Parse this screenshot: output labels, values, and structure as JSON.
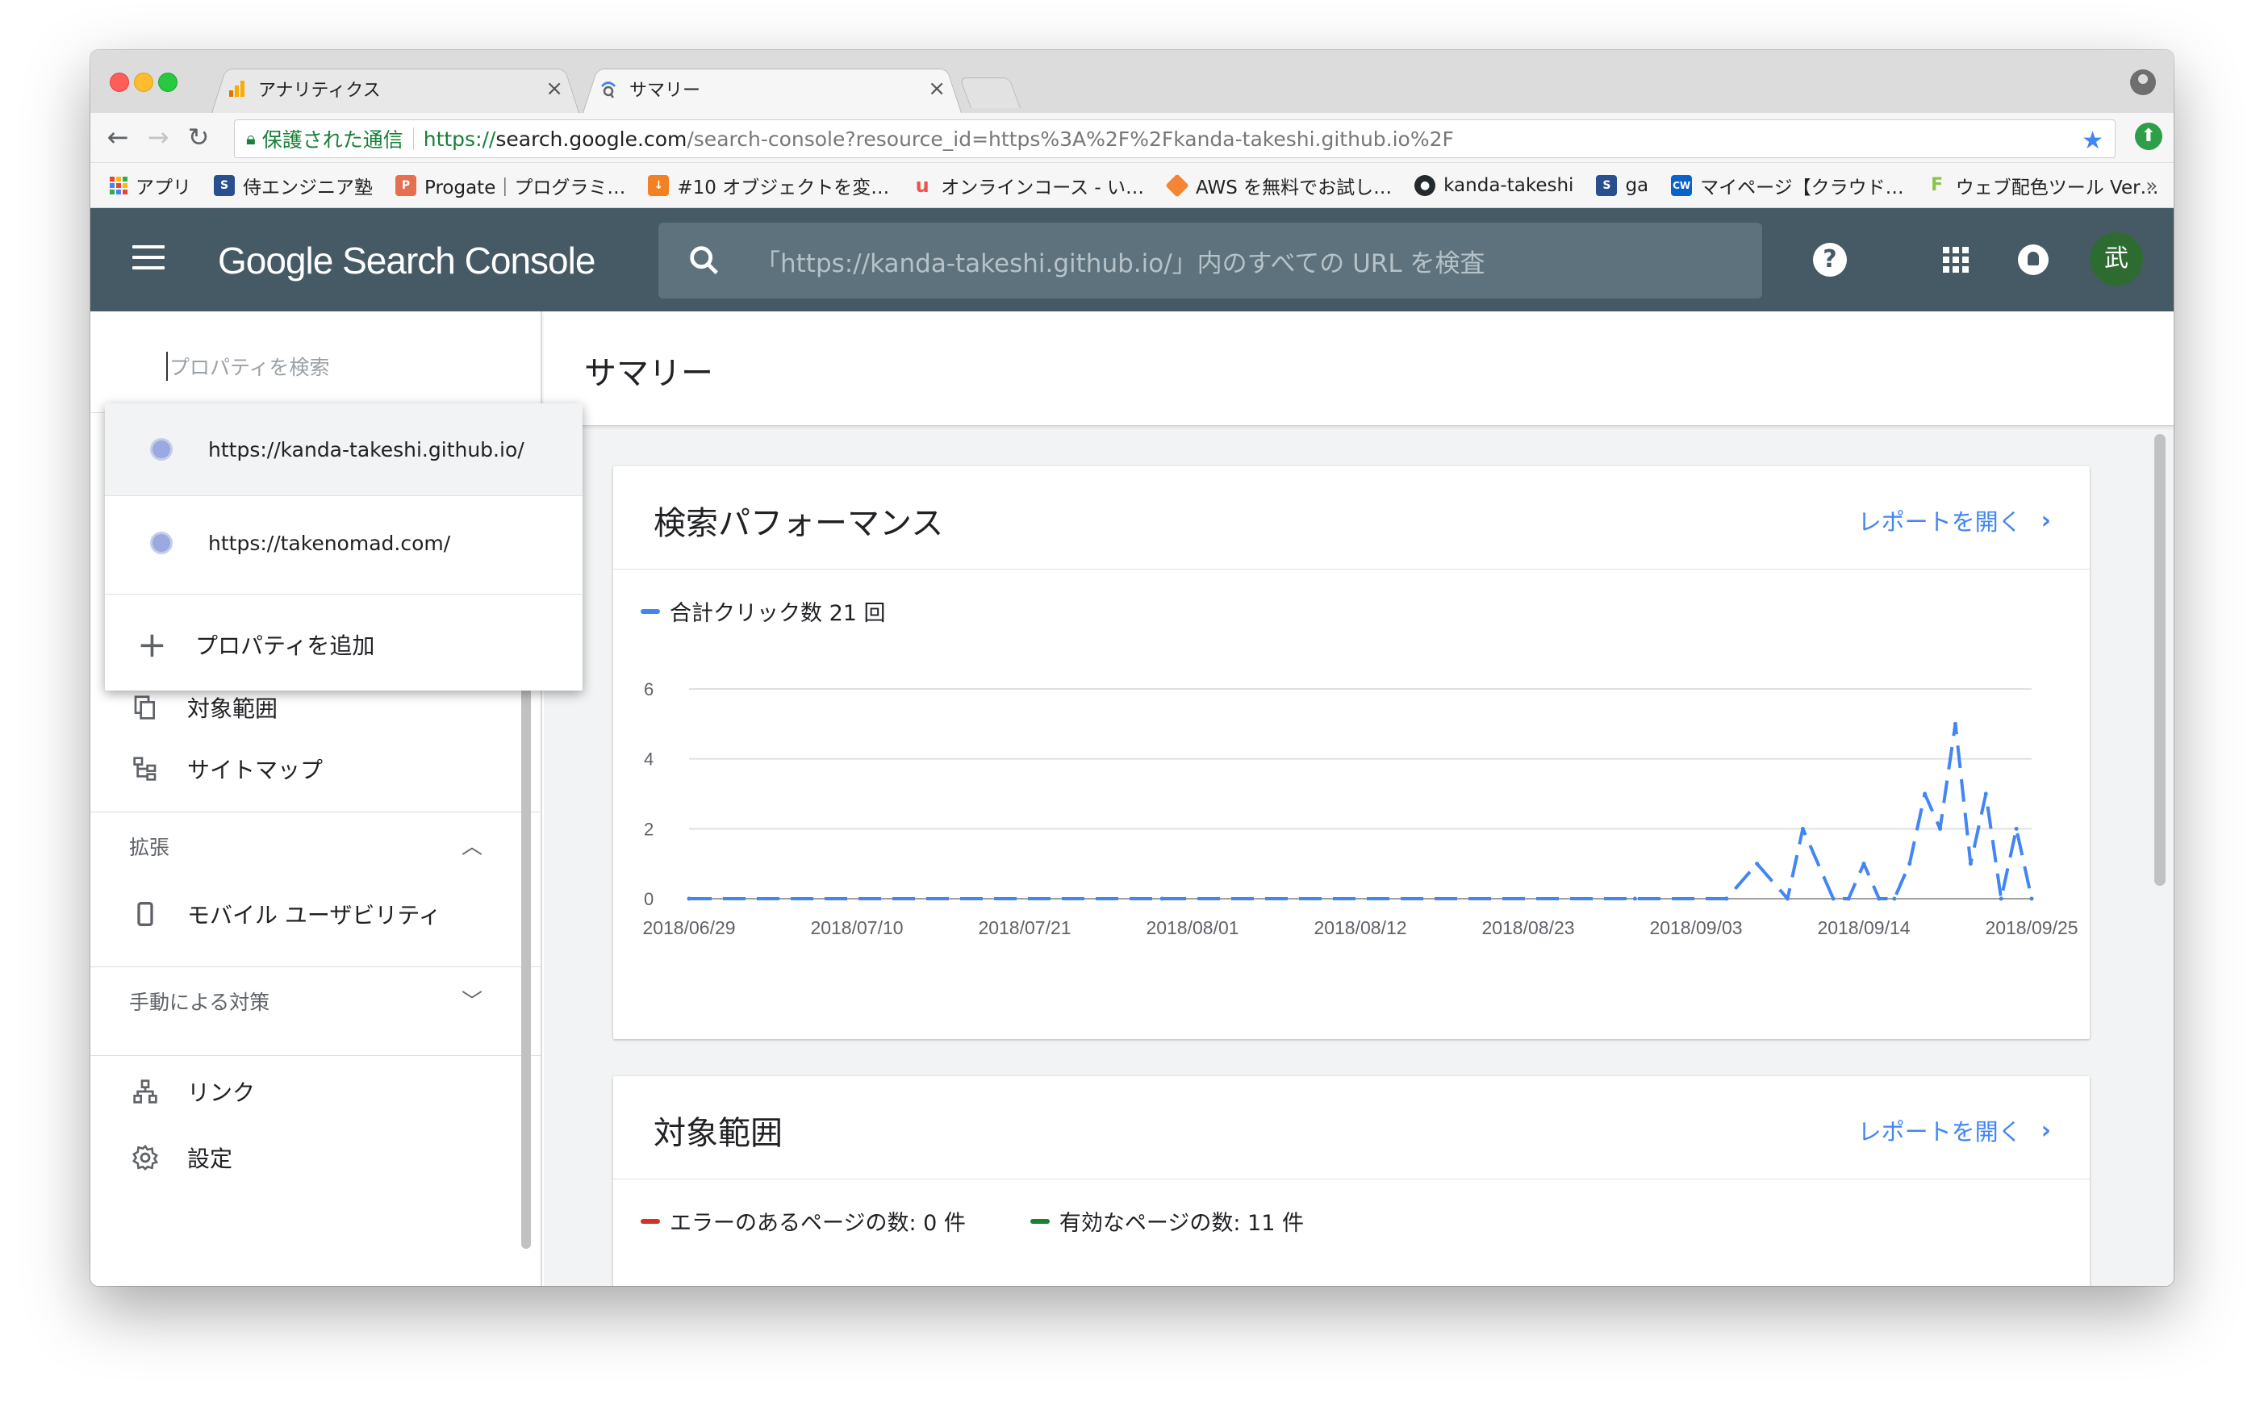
{
  "browser": {
    "tabs": [
      {
        "label": "アナリティクス",
        "close": "×"
      },
      {
        "label": "サマリー",
        "close": "×"
      }
    ],
    "omnibox": {
      "secure_label": "保護された通信",
      "url_scheme": "https://",
      "url_host": "search.google.com",
      "url_path": "/search-console?resource_id=https%3A%2F%2Fkanda-takeshi.github.io%2F"
    },
    "bookmarks": [
      {
        "label": "アプリ",
        "icon": "apps-icon",
        "color": "#4285f4"
      },
      {
        "label": "侍エンジニア塾",
        "icon": "samurai-icon",
        "color": "#2a4f8f"
      },
      {
        "label": "Progate｜プログラミ…",
        "icon": "progate-icon",
        "color": "#e66f4f"
      },
      {
        "label": "#10 オブジェクトを変…",
        "icon": "download-icon",
        "color": "#f48024"
      },
      {
        "label": "オンラインコース - い…",
        "icon": "udemy-icon",
        "color": "#ec5252"
      },
      {
        "label": "AWS を無料でお試し…",
        "icon": "aws-icon",
        "color": "#f58534"
      },
      {
        "label": "kanda-takeshi",
        "icon": "github-icon",
        "color": "#24292e"
      },
      {
        "label": "ga",
        "icon": "samurai-icon",
        "color": "#2a4f8f"
      },
      {
        "label": "マイページ【クラウド…",
        "icon": "cw-icon",
        "color": "#0a63c9"
      },
      {
        "label": "ウェブ配色ツール Ver…",
        "icon": "palette-icon",
        "color": "#8bc34a"
      }
    ],
    "bookmarks_more": "»"
  },
  "header": {
    "brand": "Google Search Console",
    "search_placeholder": "「https://kanda-takeshi.github.io/」内のすべての URL を検査",
    "help": "?",
    "avatar": "武"
  },
  "sidebar": {
    "property_search_placeholder": "プロパティを検索",
    "dropdown": {
      "properties": [
        "https://kanda-takeshi.github.io/",
        "https://takenomad.com/"
      ],
      "add_label": "プロパティを追加"
    },
    "items_top": [
      {
        "label": "対象範囲",
        "icon": "coverage-icon"
      },
      {
        "label": "サイトマップ",
        "icon": "sitemap-icon"
      }
    ],
    "section_enhancements": {
      "label": "拡張",
      "item": "モバイル ユーザビリティ"
    },
    "section_manual": {
      "label": "手動による対策"
    },
    "items_bottom": [
      {
        "label": "リンク",
        "icon": "links-icon"
      },
      {
        "label": "設定",
        "icon": "settings-icon"
      }
    ]
  },
  "main": {
    "page_title": "サマリー",
    "performance": {
      "title": "検索パフォーマンス",
      "link": "レポートを開く",
      "legend": "合計クリック数 21 回"
    },
    "coverage": {
      "title": "対象範囲",
      "link": "レポートを開く",
      "legend_error": "エラーのあるページの数: 0 件",
      "legend_valid": "有効なページの数: 11 件"
    }
  },
  "colors": {
    "header_bg": "#455a64",
    "accent": "#4285f4",
    "error": "#d93025",
    "valid": "#188038"
  },
  "chart_data": {
    "type": "line",
    "title": "",
    "xlabel": "",
    "ylabel": "",
    "ylim": [
      0,
      6
    ],
    "yticks": [
      0,
      2,
      4,
      6
    ],
    "x_ticks": [
      "2018/06/29",
      "2018/07/10",
      "2018/07/21",
      "2018/08/01",
      "2018/08/12",
      "2018/08/23",
      "2018/09/03",
      "2018/09/14",
      "2018/09/25"
    ],
    "x_start": "2018/06/29",
    "x_end": "2018/09/25",
    "series": [
      {
        "name": "合計クリック数 21 回",
        "color": "#4285f4",
        "points": [
          [
            "2018/06/29",
            0
          ],
          [
            "2018/07/30",
            0
          ],
          [
            "2018/08/30",
            0
          ],
          [
            "2018/09/05",
            0
          ],
          [
            "2018/09/07",
            1
          ],
          [
            "2018/09/09",
            0
          ],
          [
            "2018/09/10",
            2
          ],
          [
            "2018/09/12",
            0
          ],
          [
            "2018/09/13",
            0
          ],
          [
            "2018/09/14",
            1
          ],
          [
            "2018/09/15",
            0
          ],
          [
            "2018/09/16",
            0
          ],
          [
            "2018/09/17",
            1
          ],
          [
            "2018/09/18",
            3
          ],
          [
            "2018/09/19",
            2
          ],
          [
            "2018/09/20",
            5
          ],
          [
            "2018/09/21",
            1
          ],
          [
            "2018/09/22",
            3
          ],
          [
            "2018/09/23",
            0
          ],
          [
            "2018/09/24",
            2
          ],
          [
            "2018/09/25",
            0
          ]
        ]
      }
    ]
  }
}
